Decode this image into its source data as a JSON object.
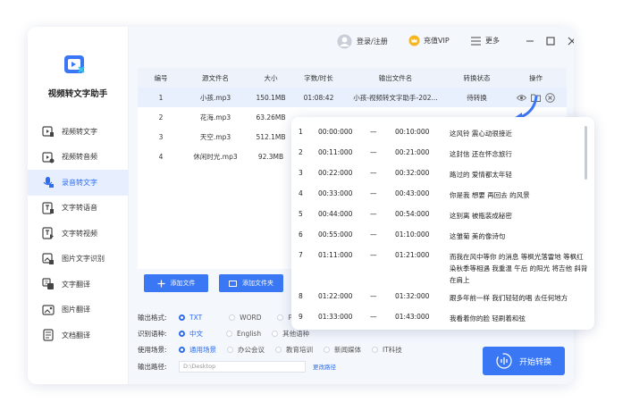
{
  "app": {
    "name": "视频转文字助手"
  },
  "sidebar": {
    "items": [
      {
        "label": "视频转文字",
        "icon": "video-to-text-icon"
      },
      {
        "label": "视频转音频",
        "icon": "video-to-audio-icon"
      },
      {
        "label": "录音转文字",
        "icon": "recording-to-text-icon",
        "active": true
      },
      {
        "label": "文字转语音",
        "icon": "text-to-speech-icon"
      },
      {
        "label": "文字转视频",
        "icon": "text-to-video-icon"
      },
      {
        "label": "图片文字识别",
        "icon": "image-ocr-icon"
      },
      {
        "label": "文字翻译",
        "icon": "text-translate-icon"
      },
      {
        "label": "图片翻译",
        "icon": "image-translate-icon"
      },
      {
        "label": "文档翻译",
        "icon": "document-translate-icon"
      }
    ]
  },
  "topbar": {
    "login": "登录/注册",
    "vip": "充值VIP",
    "more": "更多"
  },
  "table": {
    "headers": [
      "编号",
      "源文件名",
      "大小",
      "字数/时长",
      "输出文件名",
      "转换状态",
      "操作"
    ],
    "rows": [
      {
        "num": "1",
        "name": "小孩.mp3",
        "size": "150.1MB",
        "dur": "01:08:42",
        "out": "小孩-视频转文字助手-202...",
        "status": "待转换"
      },
      {
        "num": "2",
        "name": "花海.mp3",
        "size": "63.26MB"
      },
      {
        "num": "3",
        "name": "天空.mp3",
        "size": "512.1MB"
      },
      {
        "num": "4",
        "name": "休闲时光.mp3",
        "size": "92.3MB"
      }
    ]
  },
  "buttons": {
    "add_file": "添加文件",
    "add_folder": "添加文件夹",
    "start": "开始转换"
  },
  "options": {
    "format_label": "输出格式:",
    "formats": [
      "TXT",
      "WORD",
      "P"
    ],
    "lang_label": "识别语种:",
    "langs": [
      "中文",
      "English",
      "其他语种"
    ],
    "scene_label": "使用场景:",
    "scenes": [
      "通用场景",
      "办公会议",
      "教育培训",
      "新闻媒体",
      "IT科技"
    ],
    "path_label": "输出路径:",
    "path_value": "D:\\Desktop",
    "change_path": "更改路径"
  },
  "transcript": {
    "dash": "—",
    "segments": [
      {
        "n": "1",
        "start": "00:00:000",
        "end": "00:10:000",
        "text": "这风铃 震心动很接近"
      },
      {
        "n": "2",
        "start": "00:11:000",
        "end": "00:21:000",
        "text": "这封信 还在怀念旅行"
      },
      {
        "n": "3",
        "start": "00:22:000",
        "end": "00:32:000",
        "text": "路过的 爱情都太年轻"
      },
      {
        "n": "4",
        "start": "00:33:000",
        "end": "00:43:000",
        "text": "你是我 想要 再回去 的风景"
      },
      {
        "n": "5",
        "start": "00:44:000",
        "end": "00:54:000",
        "text": "这别离 被瓶装成秘密"
      },
      {
        "n": "6",
        "start": "00:55:000",
        "end": "01:10:000",
        "text": "这雏菊 美的像诗句"
      },
      {
        "n": "7",
        "start": "01:11:000",
        "end": "01:21:000",
        "text": "而我在风中等你 的消息 等枫光落雷地 等枫红染秋季等相遇 我重温 午后 的阳光 将吉他 斜背 在肩上"
      },
      {
        "n": "8",
        "start": "01:22:000",
        "end": "01:32:000",
        "text": "跟多年前一样 我们轻轻的唱 去任何地方"
      },
      {
        "n": "9",
        "start": "01:33:000",
        "end": "01:43:000",
        "text": "我看着你的脸 轻刷着和弦"
      }
    ]
  }
}
